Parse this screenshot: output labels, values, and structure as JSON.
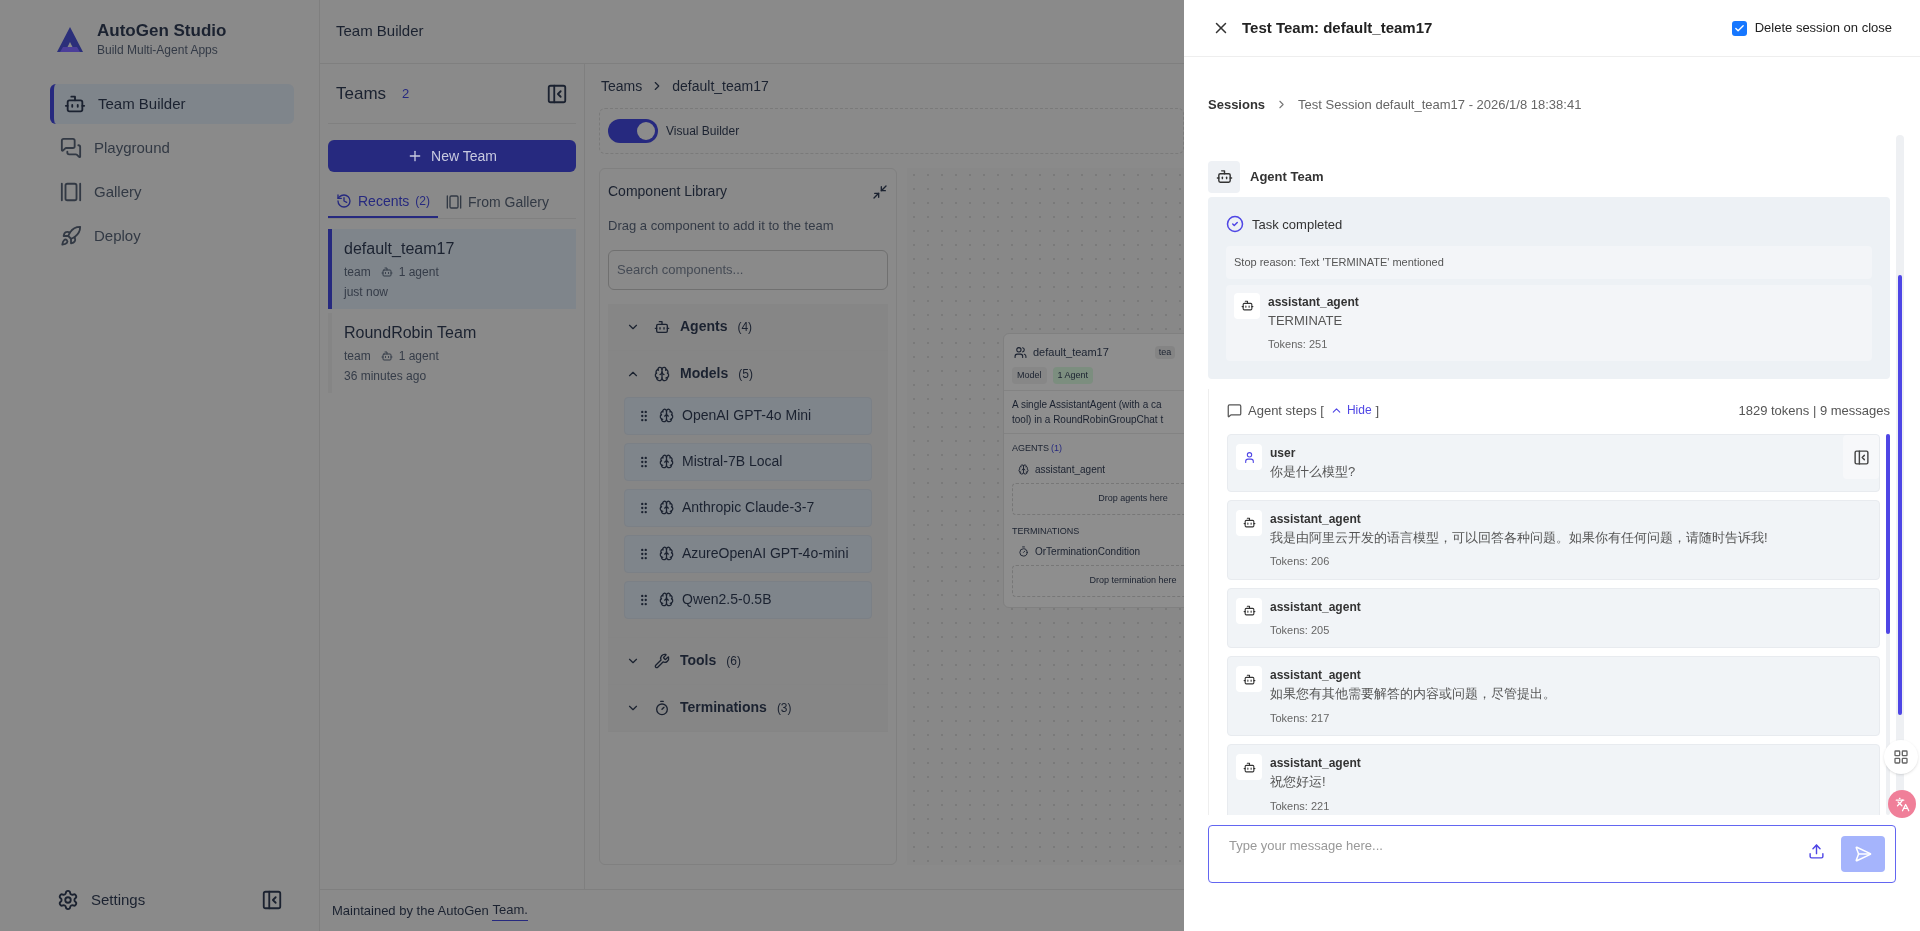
{
  "app": {
    "title": "AutoGen Studio",
    "subtitle": "Build Multi-Agent Apps"
  },
  "nav": [
    {
      "label": "Team Builder",
      "selected": true
    },
    {
      "label": "Playground",
      "selected": false
    },
    {
      "label": "Gallery",
      "selected": false
    },
    {
      "label": "Deploy",
      "selected": false
    }
  ],
  "settings": "Settings",
  "header": "Team Builder",
  "teams_panel": {
    "title": "Teams",
    "count": "2",
    "new_button": "New Team",
    "tabs": [
      {
        "label": "Recents",
        "count": "(2)",
        "selected": true
      },
      {
        "label": "From Gallery",
        "selected": false
      }
    ],
    "teams": [
      {
        "name": "default_team17",
        "type": "team",
        "agents": "1 agent",
        "time": "just now",
        "selected": true
      },
      {
        "name": "RoundRobin Team",
        "type": "team",
        "agents": "1 agent",
        "time": "36 minutes ago",
        "selected": false
      }
    ]
  },
  "breadcrumb": [
    "Teams",
    "default_team17"
  ],
  "toggle": {
    "label": "Visual Builder",
    "on": true
  },
  "library": {
    "title": "Component Library",
    "hint": "Drag a component to add it to the team",
    "search_placeholder": "Search components...",
    "sections": [
      {
        "label": "Agents",
        "count": "(4)",
        "expanded": false
      },
      {
        "label": "Models",
        "count": "(5)",
        "expanded": true,
        "items": [
          "OpenAI GPT-4o Mini",
          "Mistral-7B Local",
          "Anthropic Claude-3-7",
          "AzureOpenAI GPT-4o-mini",
          "Qwen2.5-0.5B"
        ]
      },
      {
        "label": "Tools",
        "count": "(6)",
        "expanded": false
      },
      {
        "label": "Terminations",
        "count": "(3)",
        "expanded": false
      }
    ]
  },
  "canvas_card": {
    "title": "default_team17",
    "badge": "tea",
    "tags": [
      "Model",
      "1 Agent"
    ],
    "description": [
      "A single AssistantAgent (with a ca",
      "tool) in a RoundRobinGroupChat t"
    ],
    "agents_label": "AGENTS",
    "agents_count": "(1)",
    "agent": "assistant_agent",
    "agents_drop": "Drop agents here",
    "terminations_label": "TERMINATIONS",
    "termination": "OrTerminationCondition",
    "terminations_drop": "Drop termination here"
  },
  "footer": {
    "text": "Maintained by the AutoGen ",
    "link": "Team."
  },
  "drawer": {
    "title": "Test Team: default_team17",
    "delete_on_close": {
      "label": "Delete session on close",
      "checked": true
    },
    "breadcrumb": [
      "Sessions",
      "Test Session default_team17 - 2026/1/8 18:38:41"
    ],
    "team_label": "Agent Team",
    "status": "Task completed",
    "stop_reason": "Stop reason: Text 'TERMINATE' mentioned",
    "final": {
      "name": "assistant_agent",
      "text": "TERMINATE",
      "tokens": "Tokens: 251"
    },
    "steps": {
      "label": "Agent steps [",
      "toggle": "Hide",
      "close": "]",
      "summary": "1829 tokens | 9 messages",
      "expanded": true
    },
    "messages": [
      {
        "kind": "user",
        "name": "user",
        "text": "你是什么模型?"
      },
      {
        "kind": "agent",
        "name": "assistant_agent",
        "text": "我是由阿里云开发的语言模型，可以回答各种问题。如果你有任何问题，请随时告诉我!",
        "tokens": "Tokens: 206"
      },
      {
        "kind": "agent",
        "name": "assistant_agent",
        "tokens": "Tokens: 205"
      },
      {
        "kind": "agent",
        "name": "assistant_agent",
        "text": "如果您有其他需要解答的内容或问题，尽管提出。",
        "tokens": "Tokens: 217"
      },
      {
        "kind": "agent",
        "name": "assistant_agent",
        "text": "祝您好运!",
        "tokens": "Tokens: 221"
      }
    ],
    "input_placeholder": "Type your message here..."
  }
}
